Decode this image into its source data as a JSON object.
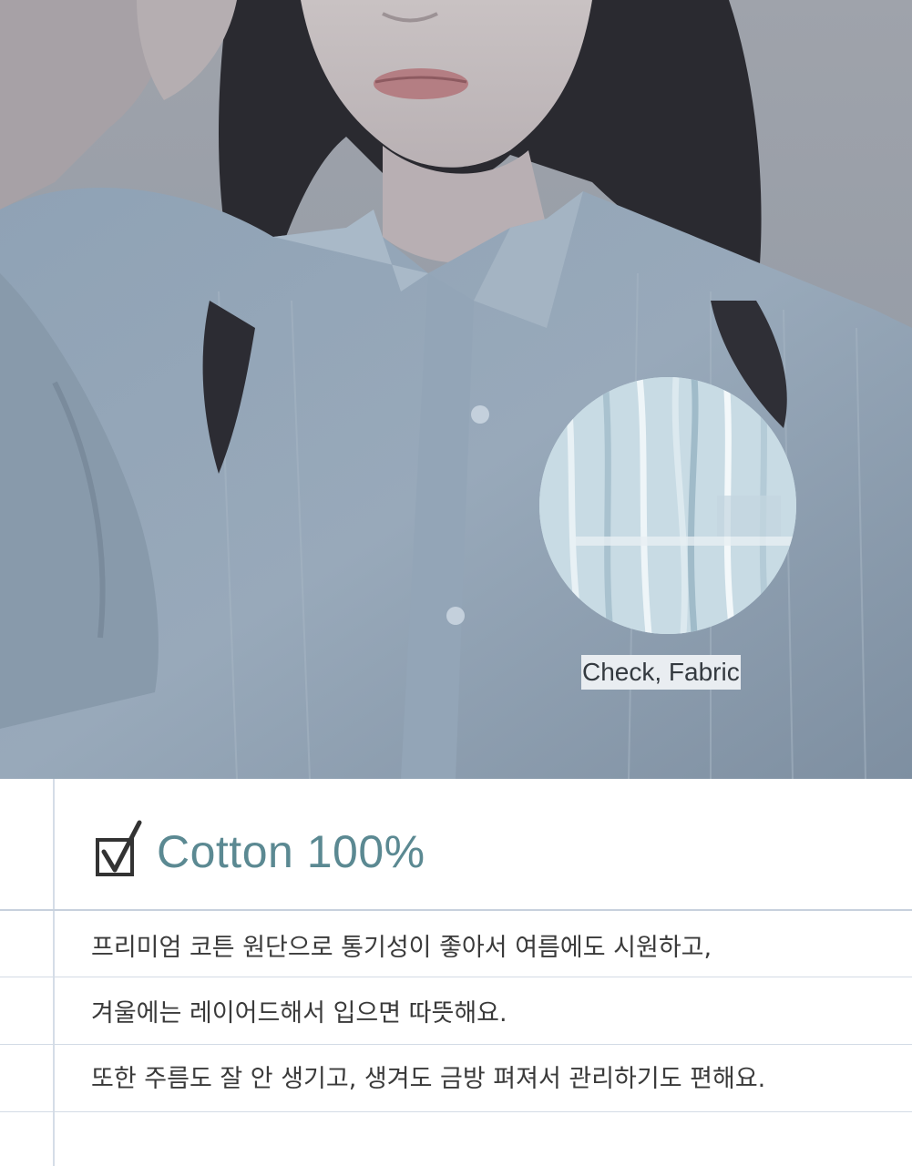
{
  "photo": {
    "alt": "Model wearing a light blue striped cotton shirt",
    "zoom_label": "Check, Fabric"
  },
  "feature": {
    "icon": "checkbox-checked-icon",
    "title": "Cotton 100%",
    "title_color": "#5b8992"
  },
  "description": {
    "lines": [
      "프리미엄 코튼 원단으로 통기성이 좋아서 여름에도 시원하고,",
      "겨울에는 레이어드해서 입으면 따뜻해요.",
      "또한 주름도 잘 안 생기고, 생겨도 금방 펴져서 관리하기도 편해요."
    ]
  }
}
